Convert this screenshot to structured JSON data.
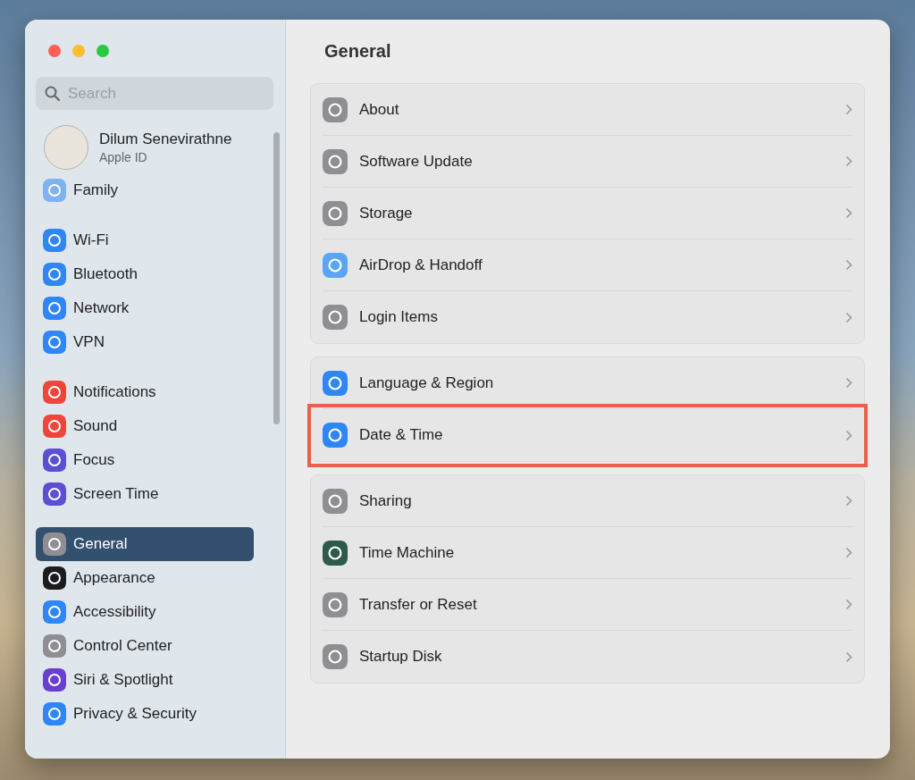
{
  "sidebar": {
    "search": {
      "placeholder": "Search"
    },
    "account": {
      "name": "Dilum Senevirathne",
      "subtitle": "Apple ID"
    },
    "groups": [
      [
        {
          "label": "Family",
          "color": "#7fb2f0",
          "selected": false
        }
      ],
      [
        {
          "label": "Wi-Fi",
          "color": "#2f86f6",
          "selected": false
        },
        {
          "label": "Bluetooth",
          "color": "#2f86f6",
          "selected": false
        },
        {
          "label": "Network",
          "color": "#2f86f6",
          "selected": false
        },
        {
          "label": "VPN",
          "color": "#2f86f6",
          "selected": false
        }
      ],
      [
        {
          "label": "Notifications",
          "color": "#f0453a",
          "selected": false
        },
        {
          "label": "Sound",
          "color": "#f0453a",
          "selected": false
        },
        {
          "label": "Focus",
          "color": "#5c4fd6",
          "selected": false
        },
        {
          "label": "Screen Time",
          "color": "#5c4fd6",
          "selected": false
        }
      ],
      [
        {
          "label": "General",
          "color": "#8e8e93",
          "selected": true
        },
        {
          "label": "Appearance",
          "color": "#1c1c1e",
          "selected": false
        },
        {
          "label": "Accessibility",
          "color": "#2f86f6",
          "selected": false
        },
        {
          "label": "Control Center",
          "color": "#8e8e93",
          "selected": false
        },
        {
          "label": "Siri & Spotlight",
          "color": "#6a3fd0",
          "selected": false
        },
        {
          "label": "Privacy & Security",
          "color": "#2f86f6",
          "selected": false
        }
      ]
    ]
  },
  "main": {
    "title": "General",
    "groups": [
      [
        {
          "label": "About",
          "color": "#8e8e93",
          "highlighted": false
        },
        {
          "label": "Software Update",
          "color": "#8e8e93",
          "highlighted": false
        },
        {
          "label": "Storage",
          "color": "#8e8e93",
          "highlighted": false
        },
        {
          "label": "AirDrop & Handoff",
          "color": "#5aa6f5",
          "highlighted": false
        },
        {
          "label": "Login Items",
          "color": "#8e8e93",
          "highlighted": false
        }
      ],
      [
        {
          "label": "Language & Region",
          "color": "#2f86f6",
          "highlighted": false
        },
        {
          "label": "Date & Time",
          "color": "#2f86f6",
          "highlighted": true
        }
      ],
      [
        {
          "label": "Sharing",
          "color": "#8e8e93",
          "highlighted": false
        },
        {
          "label": "Time Machine",
          "color": "#2d5a4a",
          "highlighted": false
        },
        {
          "label": "Transfer or Reset",
          "color": "#8e8e93",
          "highlighted": false
        },
        {
          "label": "Startup Disk",
          "color": "#8e8e93",
          "highlighted": false
        }
      ]
    ]
  }
}
